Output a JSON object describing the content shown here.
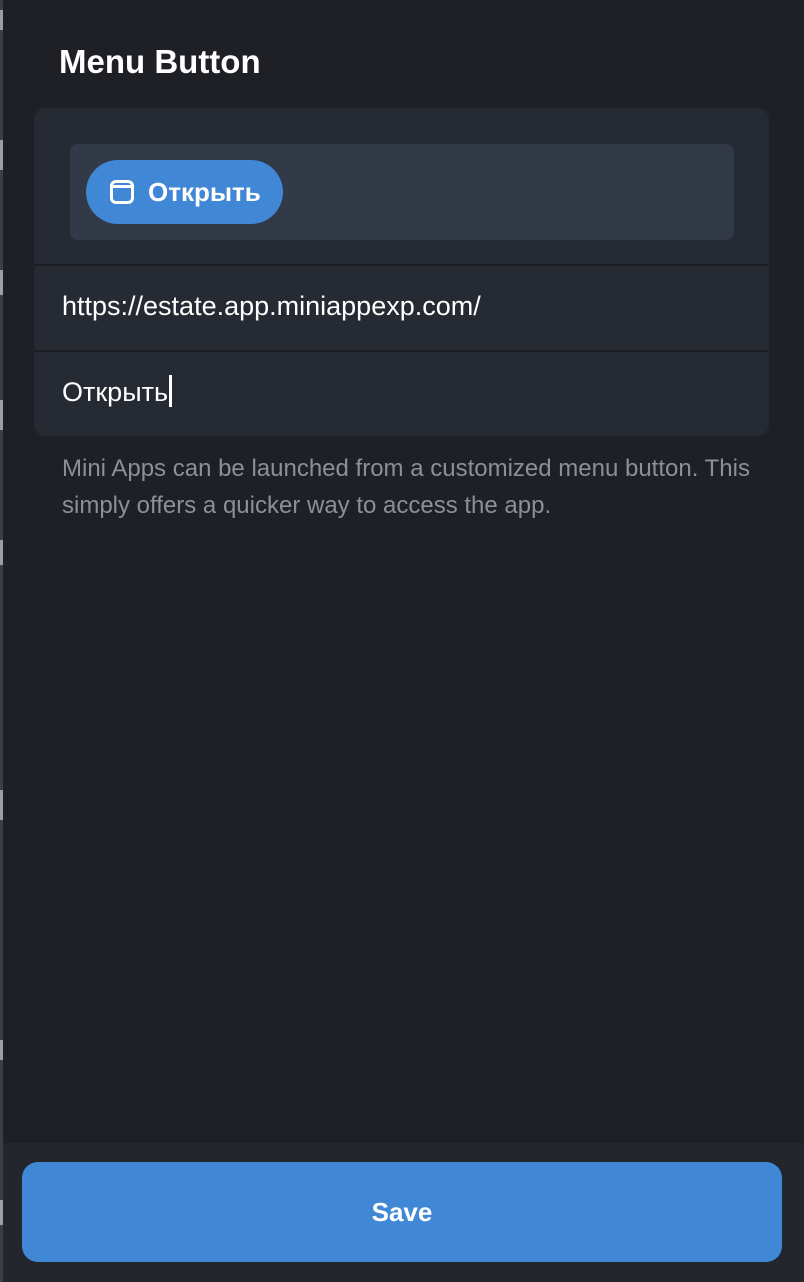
{
  "dialog": {
    "title": "Menu Button"
  },
  "preview": {
    "button_icon": "window-icon",
    "button_label": "Открыть"
  },
  "form": {
    "url_value": "https://estate.app.miniappexp.com/",
    "text_value": "Открыть"
  },
  "hint": "Mini Apps can be launched from a customized menu button. This simply offers a quicker way to access the app.",
  "footer": {
    "save_label": "Save"
  },
  "colors": {
    "background": "#1e2025",
    "card": "#262a33",
    "preview_area": "#323a47",
    "accent": "#4088d6",
    "hint_text": "#8a9099"
  }
}
